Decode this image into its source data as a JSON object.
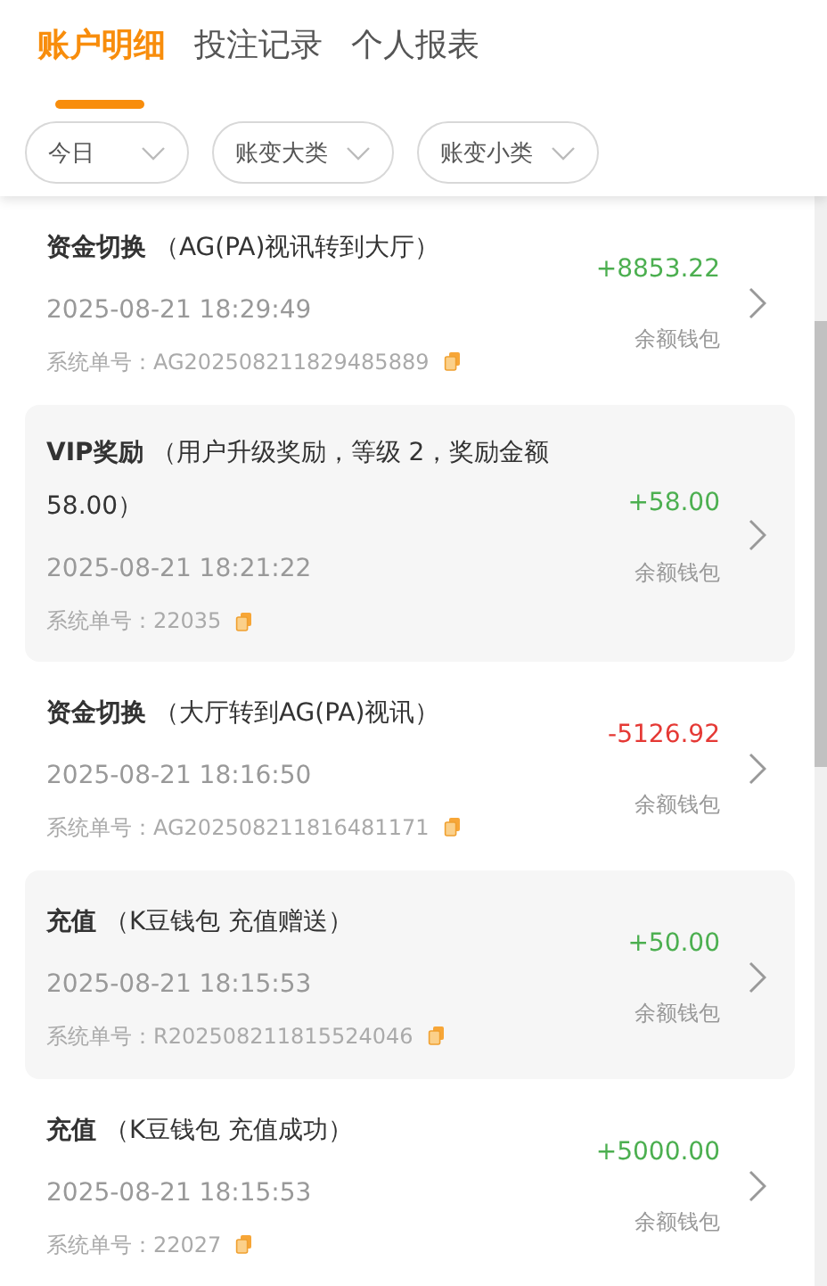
{
  "tabs": [
    {
      "label": "账户明细",
      "selected": true
    },
    {
      "label": "投注记录",
      "selected": false
    },
    {
      "label": "个人报表",
      "selected": false
    }
  ],
  "filters": [
    {
      "label": "今日"
    },
    {
      "label": "账变大类"
    },
    {
      "label": "账变小类"
    }
  ],
  "records": [
    {
      "title": "**资金切换** （AG(PA)视讯转到大厅）",
      "time": "2025-08-21 18:29:49",
      "order": "系统单号：AG202508211829485889",
      "amount": "+8853.22",
      "kind": "credit",
      "wallet": "余额钱包"
    },
    {
      "title": "**VIP奖励** （用户升级奖励，等级 2，奖励金额 58.00）",
      "time": "2025-08-21 18:21:22",
      "order": "系统单号：22035",
      "amount": "+58.00",
      "kind": "credit",
      "wallet": "余额钱包"
    },
    {
      "title": "**资金切换** （大厅转到AG(PA)视讯）",
      "time": "2025-08-21 18:16:50",
      "order": "系统单号：AG202508211816481171",
      "amount": "-5126.92",
      "kind": "debit",
      "wallet": "余额钱包"
    },
    {
      "title": "**充值** （K豆钱包 充值赠送）",
      "time": "2025-08-21 18:15:53",
      "order": "系统单号：R202508211815524046",
      "amount": "+50.00",
      "kind": "credit",
      "wallet": "余额钱包"
    },
    {
      "title": "**充值** （K豆钱包 充值成功）",
      "time": "2025-08-21 18:15:53",
      "order": "系统单号：22027",
      "amount": "+5000.00",
      "kind": "credit",
      "wallet": "余额钱包"
    }
  ]
}
